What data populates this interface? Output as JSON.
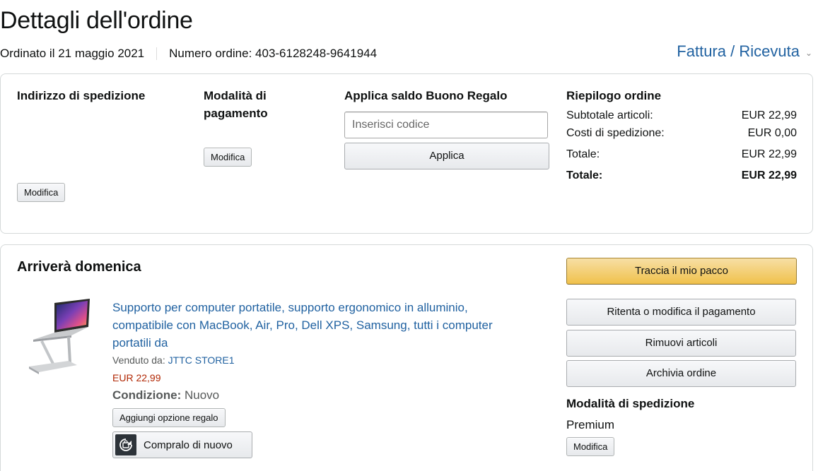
{
  "header": {
    "title": "Dettagli dell'ordine",
    "ordered_on": "Ordinato il 21 maggio 2021",
    "order_number": "Numero ordine: 403-6128248-9641944",
    "invoice_link": "Fattura / Ricevuta"
  },
  "shipping_address": {
    "heading": "Indirizzo di spedizione",
    "edit_label": "Modifica"
  },
  "payment": {
    "heading_line1": "Modalità di",
    "heading_line2": "pagamento",
    "edit_label": "Modifica"
  },
  "gift_card": {
    "heading": "Applica saldo Buono Regalo",
    "placeholder": "Inserisci codice",
    "apply_label": "Applica"
  },
  "summary": {
    "heading": "Riepilogo ordine",
    "rows": [
      {
        "label": "Subtotale articoli:",
        "value": "EUR 22,99"
      },
      {
        "label": "Costi di spedizione:",
        "value": "EUR 0,00"
      },
      {
        "label": "Totale:",
        "value": "EUR 22,99"
      },
      {
        "label": "Totale:",
        "value": "EUR 22,99"
      }
    ]
  },
  "shipment": {
    "heading": "Arriverà domenica",
    "product_title": "Supporto per computer portatile, supporto ergonomico in alluminio, compatibile con MacBook, Air, Pro, Dell XPS, Samsung, tutti i computer portatili da",
    "sold_by_label": "Venduto da:",
    "seller": "JTTC STORE1",
    "price": "EUR 22,99",
    "condition_label": "Condizione:",
    "condition_value": "Nuovo",
    "gift_option_label": "Aggiungi opzione regalo",
    "buy_again_label": "Compralo di nuovo"
  },
  "actions": {
    "track": "Traccia il mio pacco",
    "retry_payment": "Ritenta o modifica il pagamento",
    "remove_items": "Rimuovi articoli",
    "archive": "Archivia ordine"
  },
  "shipping_method": {
    "heading": "Modalità di spedizione",
    "value": "Premium",
    "edit_label": "Modifica"
  },
  "colors": {
    "link": "#2162a1",
    "price": "#b12704",
    "primary_button": "#f0c14b"
  }
}
